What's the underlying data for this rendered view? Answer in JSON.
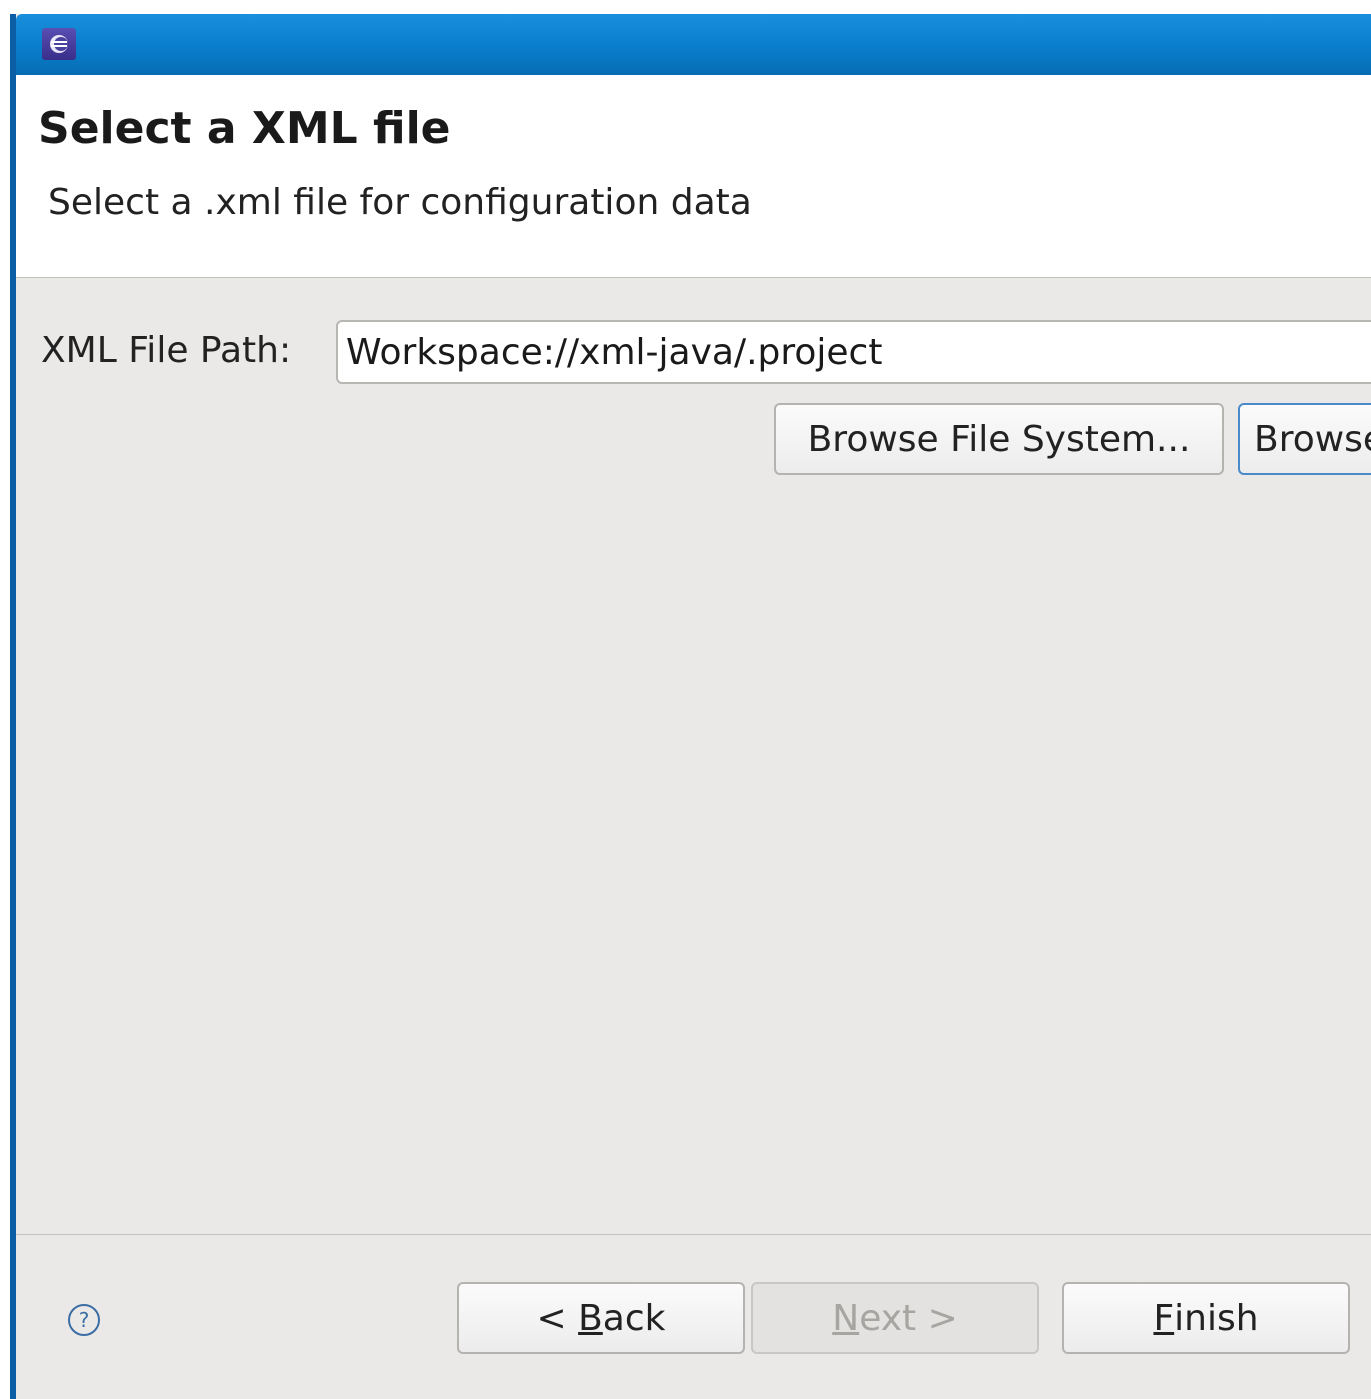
{
  "window": {
    "title": "",
    "icon": "eclipse-icon"
  },
  "header": {
    "title": "Select a XML file",
    "description": "Select a .xml file for configuration data"
  },
  "form": {
    "path_label": "XML File Path:",
    "path_value": "Workspace://xml-java/.project",
    "browse_fs_label": "Browse File System...",
    "browse_ws_label": "Browse Workspace..."
  },
  "footer": {
    "help_icon": "help-icon",
    "back": {
      "prefix": "< ",
      "mnemonic": "B",
      "rest": "ack"
    },
    "next": {
      "mnemonic": "N",
      "rest": "ext >"
    },
    "finish": {
      "mnemonic": "F",
      "rest": "inish"
    }
  },
  "colors": {
    "titlebar": "#0a7fce",
    "dialog_bg": "#ebe9e7",
    "focus_border": "#4a8ac8"
  }
}
